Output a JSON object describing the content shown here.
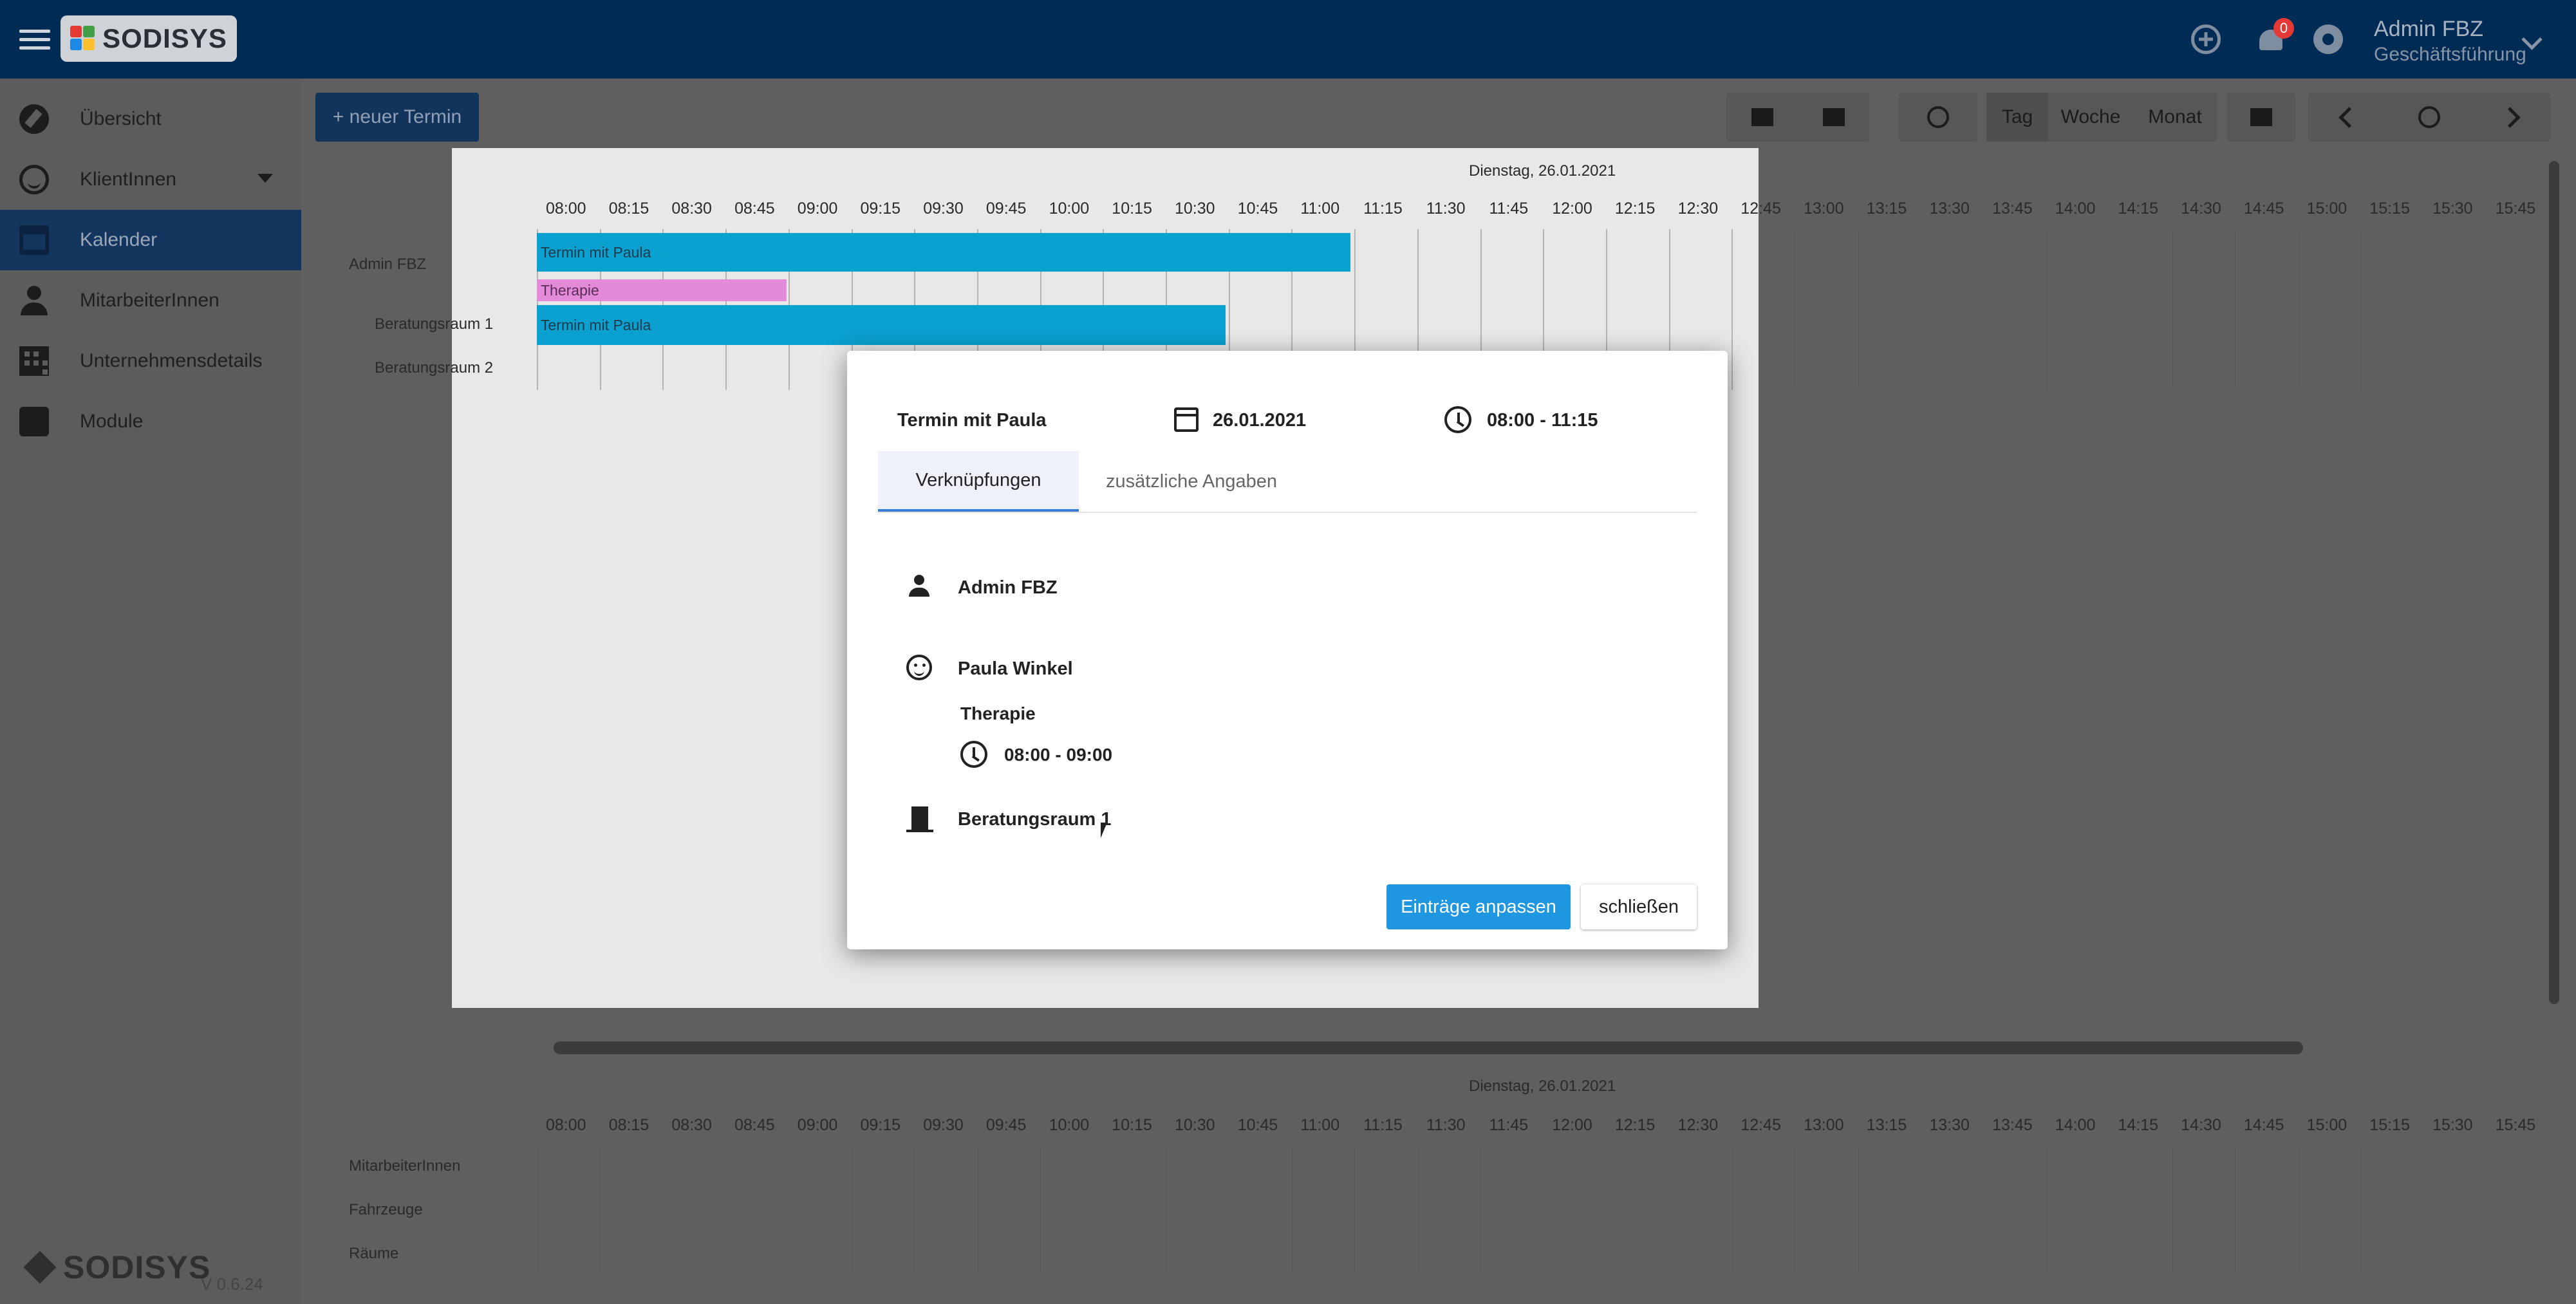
{
  "header": {
    "logo_text": "SODISYS",
    "notification_count": "0",
    "user_name": "Admin FBZ",
    "user_role": "Geschäftsführung"
  },
  "sidebar": {
    "items": [
      {
        "label": "Übersicht",
        "icon": "compass-icon"
      },
      {
        "label": "KlientInnen",
        "icon": "smile-icon"
      },
      {
        "label": "Kalender",
        "icon": "calendar-icon"
      },
      {
        "label": "MitarbeiterInnen",
        "icon": "person-icon"
      },
      {
        "label": "Unternehmensdetails",
        "icon": "building-icon"
      },
      {
        "label": "Module",
        "icon": "puzzle-icon"
      }
    ],
    "footer_logo": "SODISYS",
    "version": "V 0.6.24"
  },
  "toolbar": {
    "new_button": "+ neuer Termin",
    "view_tag": "Tag",
    "view_woche": "Woche",
    "view_monat": "Monat"
  },
  "scheduler": {
    "date_header": "Dienstag, 26.01.2021",
    "times": [
      "08:00",
      "08:15",
      "08:30",
      "08:45",
      "09:00",
      "09:15",
      "09:30",
      "09:45",
      "10:00",
      "10:15",
      "10:30",
      "10:45",
      "11:00",
      "11:15",
      "11:30",
      "11:45",
      "12:00",
      "12:15",
      "12:30",
      "12:45",
      "13:00",
      "13:15",
      "13:30",
      "13:45",
      "14:00",
      "14:15",
      "14:30",
      "14:45",
      "15:00",
      "15:15",
      "15:30",
      "15:45"
    ],
    "resources": [
      "Admin FBZ",
      "Beratungsraum 1",
      "Beratungsraum 2"
    ],
    "events": [
      {
        "label": "Termin mit Paula"
      },
      {
        "label": "Therapie"
      },
      {
        "label": "Termin mit Paula"
      }
    ],
    "bottom_date_header": "Dienstag, 26.01.2021",
    "bottom_resources": [
      "MitarbeiterInnen",
      "Fahrzeuge",
      "Räume"
    ]
  },
  "dialog": {
    "title": "Termin mit Paula",
    "date": "26.01.2021",
    "time": "08:00 - 11:15",
    "tabs": [
      "Verknüpfungen",
      "zusätzliche Angaben"
    ],
    "employee": "Admin FBZ",
    "client": "Paula Winkel",
    "service": "Therapie",
    "service_time": "08:00 - 09:00",
    "room": "Beratungsraum 1",
    "primary_button": "Einträge anpassen",
    "close_button": "schließen"
  }
}
